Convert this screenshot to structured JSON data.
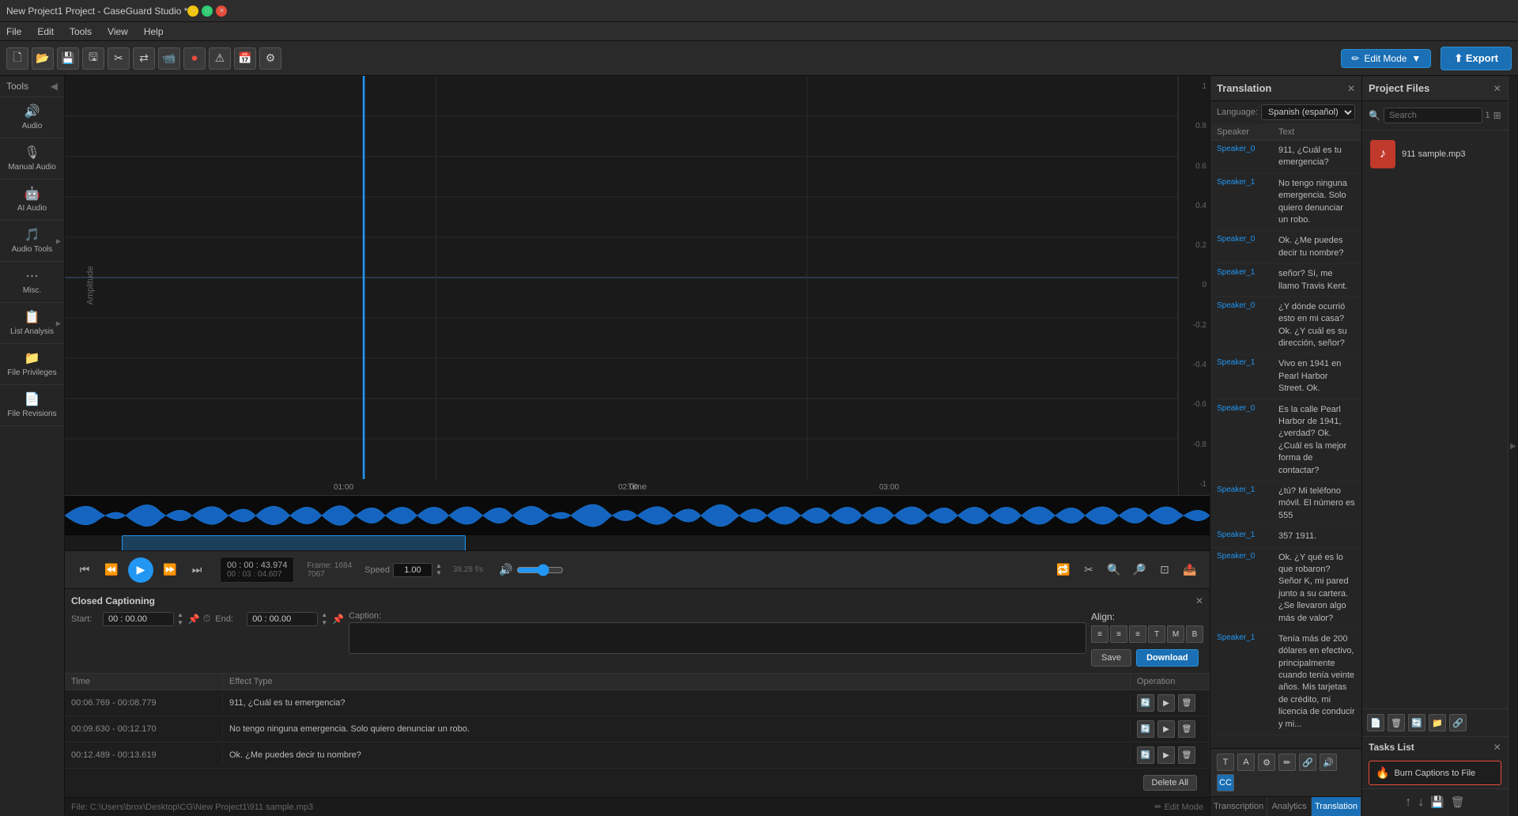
{
  "window": {
    "title": "New Project1 Project - CaseGuard Studio *",
    "min_btn": "–",
    "max_btn": "□",
    "close_btn": "✕"
  },
  "menu": {
    "items": [
      "File",
      "Edit",
      "Tools",
      "View",
      "Help"
    ]
  },
  "toolbar": {
    "edit_mode_label": "Edit Mode",
    "export_label": "⬆ Export"
  },
  "tools": {
    "header": "Tools",
    "items": [
      {
        "icon": "🔊",
        "label": "Audio",
        "arrow": false
      },
      {
        "icon": "🎙",
        "label": "Manual Audio",
        "arrow": false
      },
      {
        "icon": "🤖",
        "label": "AI Audio",
        "arrow": false
      },
      {
        "icon": "🎵",
        "label": "Audio Tools",
        "arrow": true
      },
      {
        "icon": "⋯",
        "label": "Misc.",
        "arrow": false
      },
      {
        "icon": "📋",
        "label": "List Analysis",
        "arrow": true
      },
      {
        "icon": "📁",
        "label": "File Privileges",
        "arrow": false
      },
      {
        "icon": "📄",
        "label": "File Revisions",
        "arrow": false
      }
    ]
  },
  "waveform": {
    "amplitude_labels": [
      "1",
      "0.8",
      "0.6",
      "0.4",
      "0.2",
      "0",
      "-0.2",
      "-0.4",
      "-0.6",
      "-0.8",
      "-1"
    ],
    "amplitude_axis_label": "Amplitude",
    "time_axis_label": "Time",
    "time_markers": [
      "01:00",
      "02:00",
      "03:00"
    ]
  },
  "playback": {
    "current_time": "00 : 00 : 43.974",
    "total_time": "00 : 03 : 04.607",
    "frame_label": "Frame: 1684",
    "frame_total": "7067",
    "speed_label": "Speed",
    "speed_value": "1.00",
    "fps_label": "38.28 f/s"
  },
  "cc_panel": {
    "title": "Closed Captioning",
    "start_label": "Start:",
    "start_value": "00 : 00.00",
    "end_label": "End:",
    "end_value": "00 : 00.00",
    "caption_label": "Caption:",
    "align_label": "Align:",
    "save_btn": "Save",
    "download_btn": "Download",
    "close_btn": "✕"
  },
  "cc_table": {
    "headers": [
      "Time",
      "Effect Type",
      "Operation"
    ],
    "rows": [
      {
        "time": "00:06.769 - 00:08.779",
        "effect": "911, ¿Cuál es tu emergencia?"
      },
      {
        "time": "00:09.630 - 00:12.170",
        "effect": "No tengo ninguna emergencia. Solo quiero denunciar un robo."
      },
      {
        "time": "00:12.489 - 00:13.619",
        "effect": "Ok. ¿Me puedes decir tu nombre?"
      }
    ],
    "delete_all_btn": "Delete All"
  },
  "translation": {
    "title": "Translation",
    "language_label": "Language:",
    "language_value": "Spanish (español)",
    "close_btn": "✕",
    "headers": [
      "Speaker",
      "Text"
    ],
    "rows": [
      {
        "speaker": "Speaker_0",
        "text": "911, ¿Cuál es tu emergencia?"
      },
      {
        "speaker": "Speaker_1",
        "text": "No tengo ninguna emergencia. Solo quiero denunciar un robo."
      },
      {
        "speaker": "Speaker_0",
        "text": "Ok. ¿Me puedes decir tu nombre?"
      },
      {
        "speaker": "Speaker_1",
        "text": "señor? Sí, me llamo Travis Kent."
      },
      {
        "speaker": "Speaker_0",
        "text": "¿Y dónde ocurrió esto en mi casa? Ok. ¿Y cuál es su dirección, señor?"
      },
      {
        "speaker": "Speaker_1",
        "text": "Vivo en 1941 en Pearl Harbor Street. Ok."
      },
      {
        "speaker": "Speaker_0",
        "text": "Es la calle Pearl Harbor de 1941, ¿verdad? Ok. ¿Cuál es la mejor forma de contactar?"
      },
      {
        "speaker": "Speaker_1",
        "text": "¿tú? Mi teléfono móvil. El número es 555"
      },
      {
        "speaker": "Speaker_1",
        "text": "357 1911."
      },
      {
        "speaker": "Speaker_0",
        "text": "Ok. ¿Y qué es lo que robaron? Señor K, mi pared junto a su cartera. ¿Se llevaron algo más de valor?"
      },
      {
        "speaker": "Speaker_1",
        "text": "Tenía más de 200 dólares en efectivo, principalmente cuando tenía veinte años. Mis tarjetas de crédito, mi licencia de conducir y mi..."
      }
    ],
    "footer_btns": [
      "T",
      "A",
      "⚙",
      "✏",
      "🔗",
      "🔊",
      "📋",
      "CC"
    ],
    "tabs": [
      "Transcription",
      "Analytics",
      "Translation"
    ]
  },
  "project_files": {
    "title": "Project Files",
    "search_placeholder": "Search",
    "search_badge": "1",
    "close_btn": "✕",
    "files": [
      {
        "name": "911 sample.mp3",
        "icon": "♪"
      }
    ],
    "action_btns": [
      "📄",
      "🗑",
      "🔄",
      "📁",
      "🔗"
    ]
  },
  "tasks": {
    "title": "Tasks List",
    "close_btn": "✕",
    "items": [
      {
        "label": "Burn Captions to File"
      }
    ]
  },
  "status_bar": {
    "file_path": "File: C:\\Users\\brox\\Desktop\\CG\\New Project1\\911 sample.mp3",
    "edit_mode": "✏ Edit Mode"
  }
}
